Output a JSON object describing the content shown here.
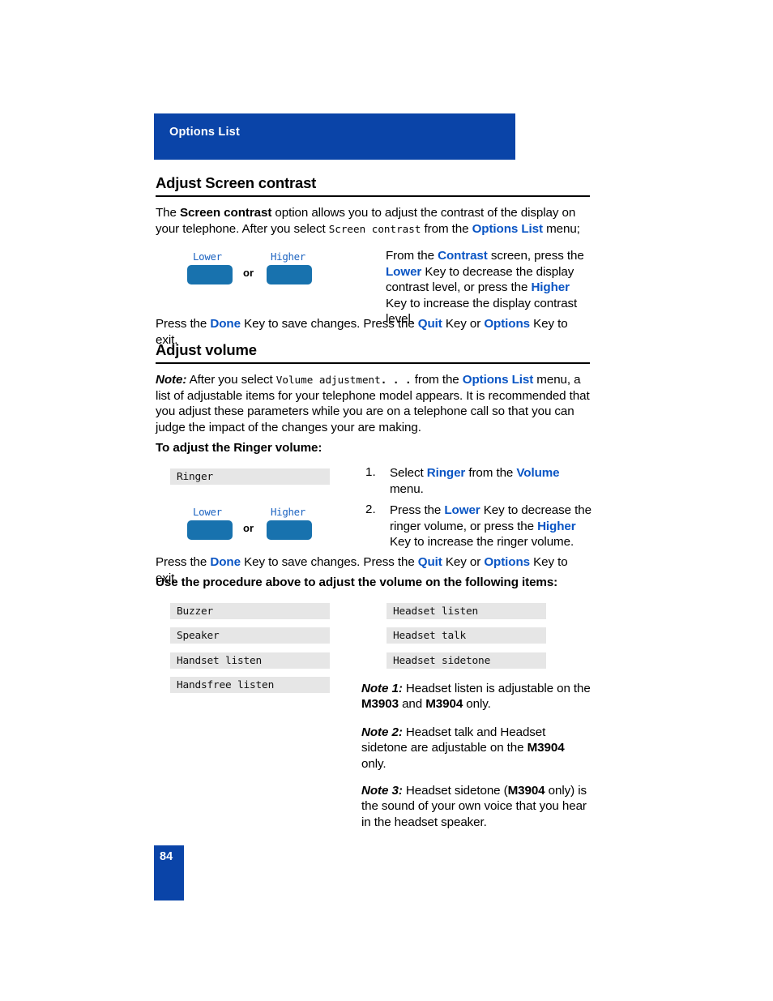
{
  "header": {
    "label": "Options List",
    "bar_color": "#0A44A8"
  },
  "sections": {
    "contrast": {
      "heading": "Adjust Screen contrast",
      "intro_1": "The ",
      "intro_bold": "Screen contrast",
      "intro_2": " option allows you to adjust the contrast of the display on your telephone. After you select ",
      "intro_lcd": "Screen contrast",
      "intro_3": " from the ",
      "intro_link": "Options List",
      "intro_4": " menu;",
      "right_text": {
        "t1": "From the ",
        "b1": "Contrast",
        "t2": " screen, press the ",
        "b2": "Lower",
        "t3": " Key to decrease the display contrast level, or press the ",
        "b3": "Higher",
        "t4": " Key to increase the display contrast level."
      },
      "footer": {
        "t1": "Press the ",
        "b1": "Done",
        "t2": " Key to save changes. Press the ",
        "b2": "Quit",
        "t3": " Key or ",
        "b3": "Options",
        "t4": " Key to exit."
      }
    },
    "volume": {
      "heading": "Adjust volume",
      "note_label": "Note:",
      "note_t1": " After you select ",
      "note_lcd": "Volume adjustment",
      "note_lcd_bold": ". . .",
      "note_t2": " from the ",
      "note_link": "Options List",
      "note_t3": " menu,  a list of adjustable items for your telephone model appears. It is recommended that you adjust these parameters while you are on a telephone call so that you can judge the impact of the changes your are making.",
      "subheading": "To adjust the Ringer volume:",
      "ringer_box": "Ringer",
      "steps": [
        {
          "number": "1.",
          "t1": "Select ",
          "b1": "Ringer",
          "t2": " from the ",
          "b2": "Volume",
          "t3": " menu."
        },
        {
          "number": "2.",
          "t1": "Press the ",
          "b1": "Lower",
          "t2": " Key to decrease the ringer volume, or press the ",
          "b2": "Higher",
          "t3": " Key to increase the ringer volume."
        }
      ],
      "footer": {
        "t1": "Press the ",
        "b1": "Done",
        "t2": " Key to save changes. Press the ",
        "b2": "Quit",
        "t3": " Key or ",
        "b3": "Options",
        "t4": " Key to exit."
      },
      "items_intro": "Use the procedure above to adjust the volume on the following items:",
      "items_left": [
        "Buzzer",
        "Speaker",
        "Handset listen",
        "Handsfree listen"
      ],
      "items_right": [
        "Headset listen",
        "Headset talk",
        "Headset sidetone"
      ],
      "notes": [
        {
          "label": "Note 1:",
          "t1": "  Headset listen is adjustable on the ",
          "b1": "M3903",
          "t2": " and ",
          "b2": "M3904",
          "t3": " only."
        },
        {
          "label": "Note 2:",
          "t1": "  Headset talk and Headset sidetone are adjustable on the ",
          "b1": "M3904",
          "t2": " only."
        },
        {
          "label": "Note 3:",
          "t1": "  Headset sidetone (",
          "b1": "M3904",
          "t2": " only) is the sound of your own voice that you hear in the headset speaker."
        }
      ]
    }
  },
  "key_graphic": {
    "lower_label": "Lower",
    "higher_label": "Higher",
    "or_label": "or"
  },
  "footer": {
    "page_number": "84"
  },
  "colors": {
    "brand_blue": "#0A44A8",
    "link_blue": "#0A55C4",
    "key_blue": "#1872AE",
    "lcd_grey": "#E6E6E6"
  }
}
